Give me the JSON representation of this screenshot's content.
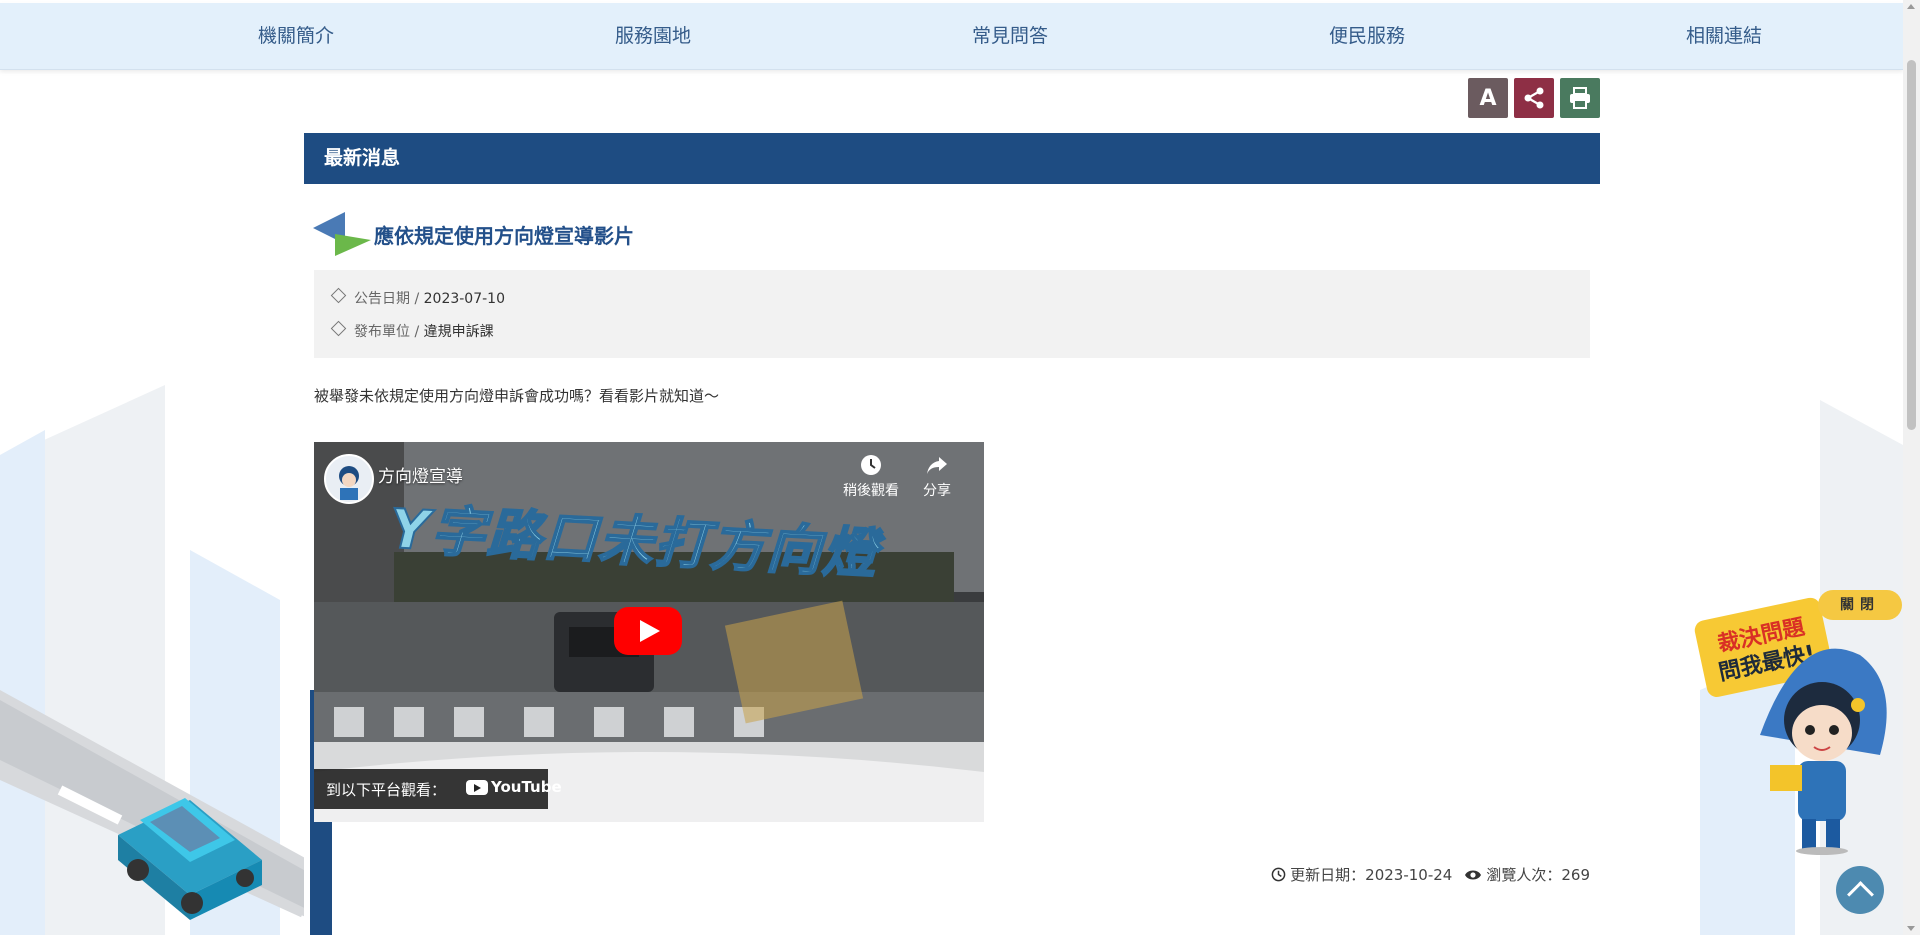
{
  "nav": {
    "items": [
      {
        "label": "機關簡介"
      },
      {
        "label": "服務園地"
      },
      {
        "label": "常見問答"
      },
      {
        "label": "便民服務"
      },
      {
        "label": "相關連結"
      }
    ]
  },
  "tools": {
    "font_size_label": "A",
    "font_size_icon": "font-size-icon",
    "share_icon": "share-icon",
    "print_icon": "print-icon",
    "colors": {
      "font": "#6b5b5f",
      "share": "#8e2f45",
      "print": "#4a7a5f"
    }
  },
  "section": {
    "title": "最新消息"
  },
  "article": {
    "title": "應依規定使用方向燈宣導影片",
    "date_label": "公告日期 / ",
    "date": "2023-07-10",
    "unit_label": "發布單位 / ",
    "unit": "違規申訴課",
    "description": "被舉發未依規定使用方向燈申訴會成功嗎？看看影片就知道～"
  },
  "video": {
    "title": "方向燈宣導",
    "overlay_text": "Y字路口未打方向燈",
    "watch_later": "稍後觀看",
    "share": "分享",
    "watch_on": "到以下平台觀看：",
    "platform": "YouTube"
  },
  "meta": {
    "updated_label": "更新日期：",
    "updated": "2023-10-24",
    "views_label": "瀏覽人次：",
    "views": "269"
  },
  "mascot": {
    "bubble_line1": "裁決問題",
    "bubble_line2": "問我最快!",
    "close": "關閉"
  },
  "colors": {
    "accent": "#1e4c82",
    "nav_bg": "#e3f0fb",
    "nav_text": "#355c8a",
    "title": "#23508a"
  }
}
